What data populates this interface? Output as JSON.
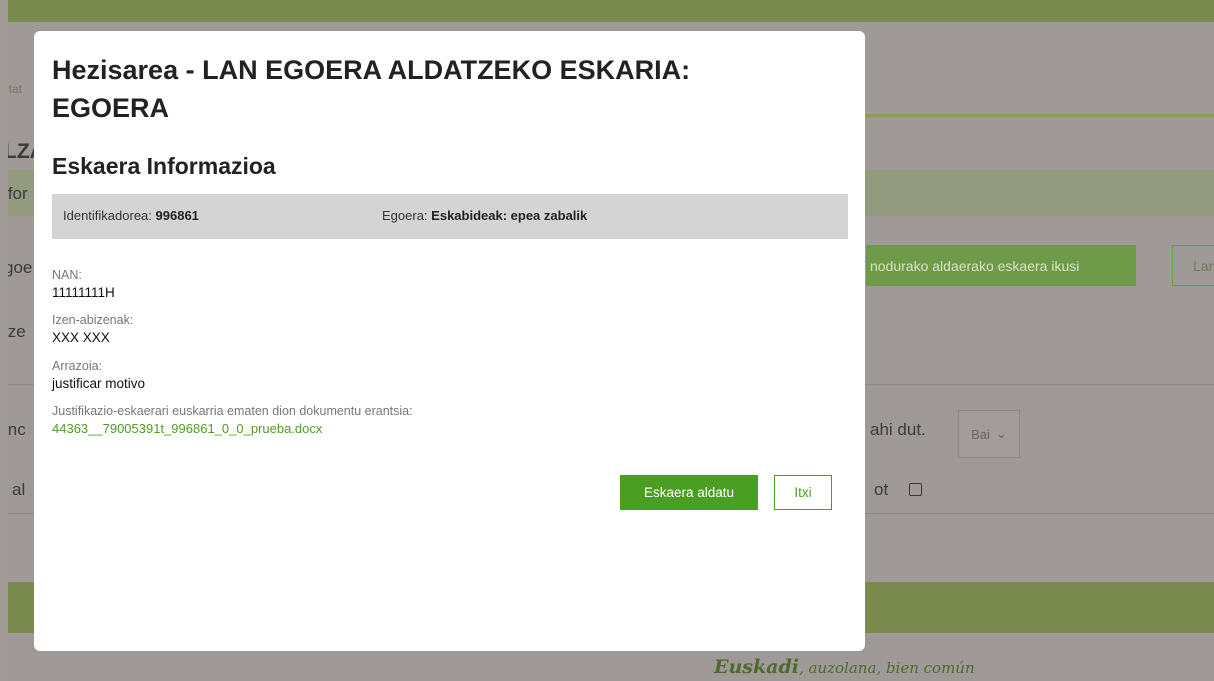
{
  "background": {
    "crumb": "itat",
    "heading_1": "LZA",
    "strip_label": "ifor",
    "row_1": "goe",
    "row_2": "ize",
    "row_3": "inc",
    "row_4": "al",
    "view_request_button": "nodurako aldaerako eskaera ikusi",
    "outline_button": "Lan",
    "want_text": "ahi dut.",
    "select_value": "Bai",
    "checkbox_text": "ot",
    "footer_brand": "Euskadi",
    "footer_slogan": ", auzolana, bien común"
  },
  "modal": {
    "title": "Hezisarea - LAN EGOERA ALDATZEKO ESKARIA: EGOERA",
    "section_title": "Eskaera Informazioa",
    "id_label": "Identifikadorea:",
    "id_value": "996861",
    "status_label": "Egoera:",
    "status_value": "Eskabideak: epea zabalik",
    "fields": {
      "nan_label": "NAN:",
      "nan_value": "11111111H",
      "name_label": "Izen-abizenak:",
      "name_value": "XXX XXX",
      "reason_label": "Arrazoia:",
      "reason_value": "justificar motivo",
      "attachment_label": "Justifikazio-eskaerari euskarria ematen dion dokumentu erantsia:",
      "attachment_value": "44363__79005391t_996861_0_0_prueba.docx"
    },
    "change_button": "Eskaera aldatu",
    "close_button": "Itxi"
  },
  "colors": {
    "accent": "#4a9f22",
    "overlay": "#9f9a97",
    "bar_green": "#7b8a4f"
  }
}
